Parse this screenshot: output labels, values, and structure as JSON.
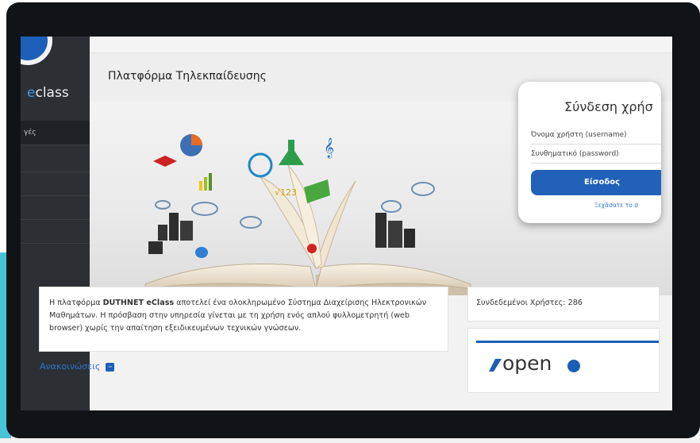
{
  "sidebar": {
    "brand_accent": "e",
    "brand_rest": "class",
    "items": [
      {
        "label": "γές",
        "active": true
      },
      {
        "label": "",
        "active": false
      },
      {
        "label": "",
        "active": false
      },
      {
        "label": "",
        "active": false
      },
      {
        "label": "",
        "active": false
      }
    ]
  },
  "header": {
    "title": "Πλατφόρμα Τηλεκπαίδευσης"
  },
  "login": {
    "title": "Σύνδεση χρήσ",
    "username_label": "Όνομα χρήστη (username)",
    "password_label": "Συνθηματικό (password)",
    "submit_label": "Είσοδος",
    "forgot_label": "Ξεχάσατε το σ"
  },
  "info": {
    "text_before": "Η πλατφόρμα ",
    "text_bold": "DUTHNET eClass",
    "text_after": " αποτελεί ένα ολοκληρωμένο Σύστημα Διαχείρισης Ηλεκτρονικών Μαθημάτων. Η πρόσβαση στην υπηρεσία γίνεται με τη χρήση ενός απλού φυλλομετρητή (web browser) χωρίς την απαίτηση εξειδικευμένων τεχνικών γνώσεων."
  },
  "online_users": {
    "text": "Συνδεδεμένοι Χρήστες: 286"
  },
  "announcements": {
    "label": "Ανακοινώσεις"
  },
  "open_logo": {
    "text": "open"
  },
  "colors": {
    "sidebar": "#2c3035",
    "primary_button": "#2161b9",
    "link": "#2e73c8",
    "frame": "#111417",
    "teal_band": "#48c4d6"
  },
  "icons": [
    "rss-icon",
    "eclass-logo-icon",
    "open-logo-icon",
    "hero-illustration"
  ]
}
